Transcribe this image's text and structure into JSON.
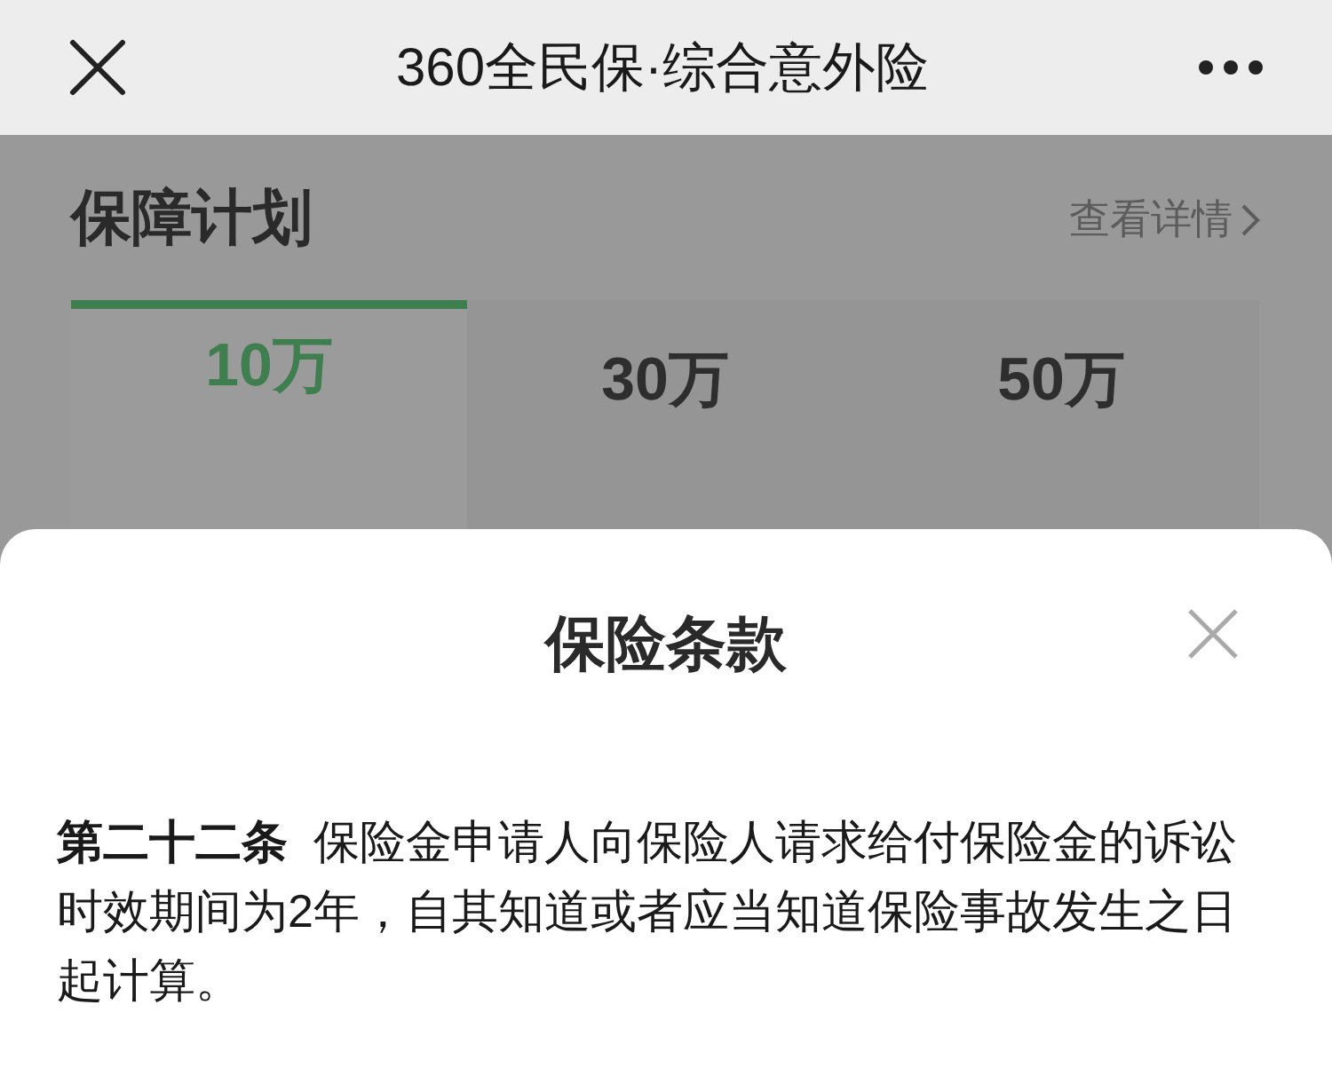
{
  "nav_bar": {
    "title": "360全民保·综合意外险"
  },
  "section": {
    "title": "保障计划",
    "link": "查看详情"
  },
  "plans": [
    {
      "label": "10万",
      "selected": true
    },
    {
      "label": "30万",
      "selected": false
    },
    {
      "label": "50万",
      "selected": false
    }
  ],
  "sheet": {
    "title": "保险条款",
    "paragraph": "**第二十二条**  保险金申请人向保险人请求给付保险金的诉讼时效期间为2年，自其知道或者应当知道保险事故发生之日起计算。"
  }
}
